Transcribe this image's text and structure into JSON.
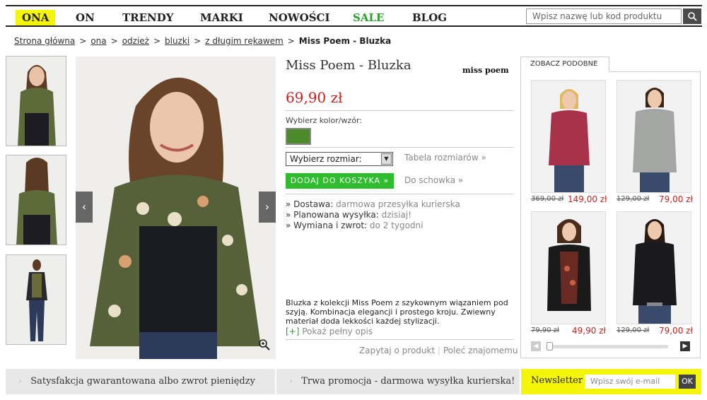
{
  "nav": {
    "items": [
      "ONA",
      "ON",
      "TRENDY",
      "MARKI",
      "NOWOŚCI",
      "SALE",
      "BLOG"
    ],
    "search_placeholder": "Wpisz nazwę lub kod produktu",
    "search_icon": "search-icon"
  },
  "breadcrumb": {
    "items": [
      "Strona główna",
      "ona",
      "odzież",
      "bluzki",
      "z długim rękawem"
    ],
    "current": "Miss Poem - Bluzka",
    "separator": ">"
  },
  "product": {
    "title": "Miss Poem - Bluzka",
    "brand": "miss poem",
    "price": "69,90 zł",
    "color_label": "Wybierz kolor/wzór:",
    "swatch_color": "#4d8a2b",
    "size_select": "Wybierz rozmiar:",
    "size_table_link": "Tabela rozmiarów »",
    "add_to_cart": "DODAJ DO KOSZYKA »",
    "wishlist_link": "Do schowka »",
    "delivery_label": "Dostawa:",
    "delivery_value": "darmowa przesyłka kurierska",
    "shipping_label": "Planowana wysyłka:",
    "shipping_value": "dzisiaj!",
    "returns_label": "Wymiana i zwrot:",
    "returns_value": "do 2 tygodni",
    "description": "Bluzka z kolekcji Miss Poem z szykownym wiązaniem pod szyją. Kombinacja elegancji i prostego kroju. Zwiewny materiał doda lekkości każdej stylizacji.",
    "more_prefix": "[+]",
    "more_label": "Pokaż pełny opis",
    "ask_link": "Zapytaj o produkt",
    "recommend_link": "Poleć znajomemu",
    "link_separator": "|"
  },
  "similar": {
    "tab_label": "ZOBACZ PODOBNE",
    "items": [
      {
        "old_price": "369,00 zł",
        "new_price": "149,00 zł"
      },
      {
        "old_price": "129,00 zł",
        "new_price": "79,00 zł"
      },
      {
        "old_price": "79,90 zł",
        "new_price": "49,90 zł"
      },
      {
        "old_price": "129,00 zł",
        "new_price": "79,00 zł"
      }
    ]
  },
  "footer": {
    "satisfaction": "Satysfakcja gwarantowana albo zwrot pieniędzy",
    "promo": "Trwa promocja - darmowa wysyłka kurierska!",
    "newsletter_label": "Newsletter",
    "newsletter_placeholder": "Wpisz swój e-mail",
    "newsletter_button": "OK"
  },
  "colors": {
    "accent_yellow": "#f5f50a",
    "sale_green": "#2aa02a",
    "price_red": "#c8201b",
    "cart_green": "#2fbd2f"
  }
}
